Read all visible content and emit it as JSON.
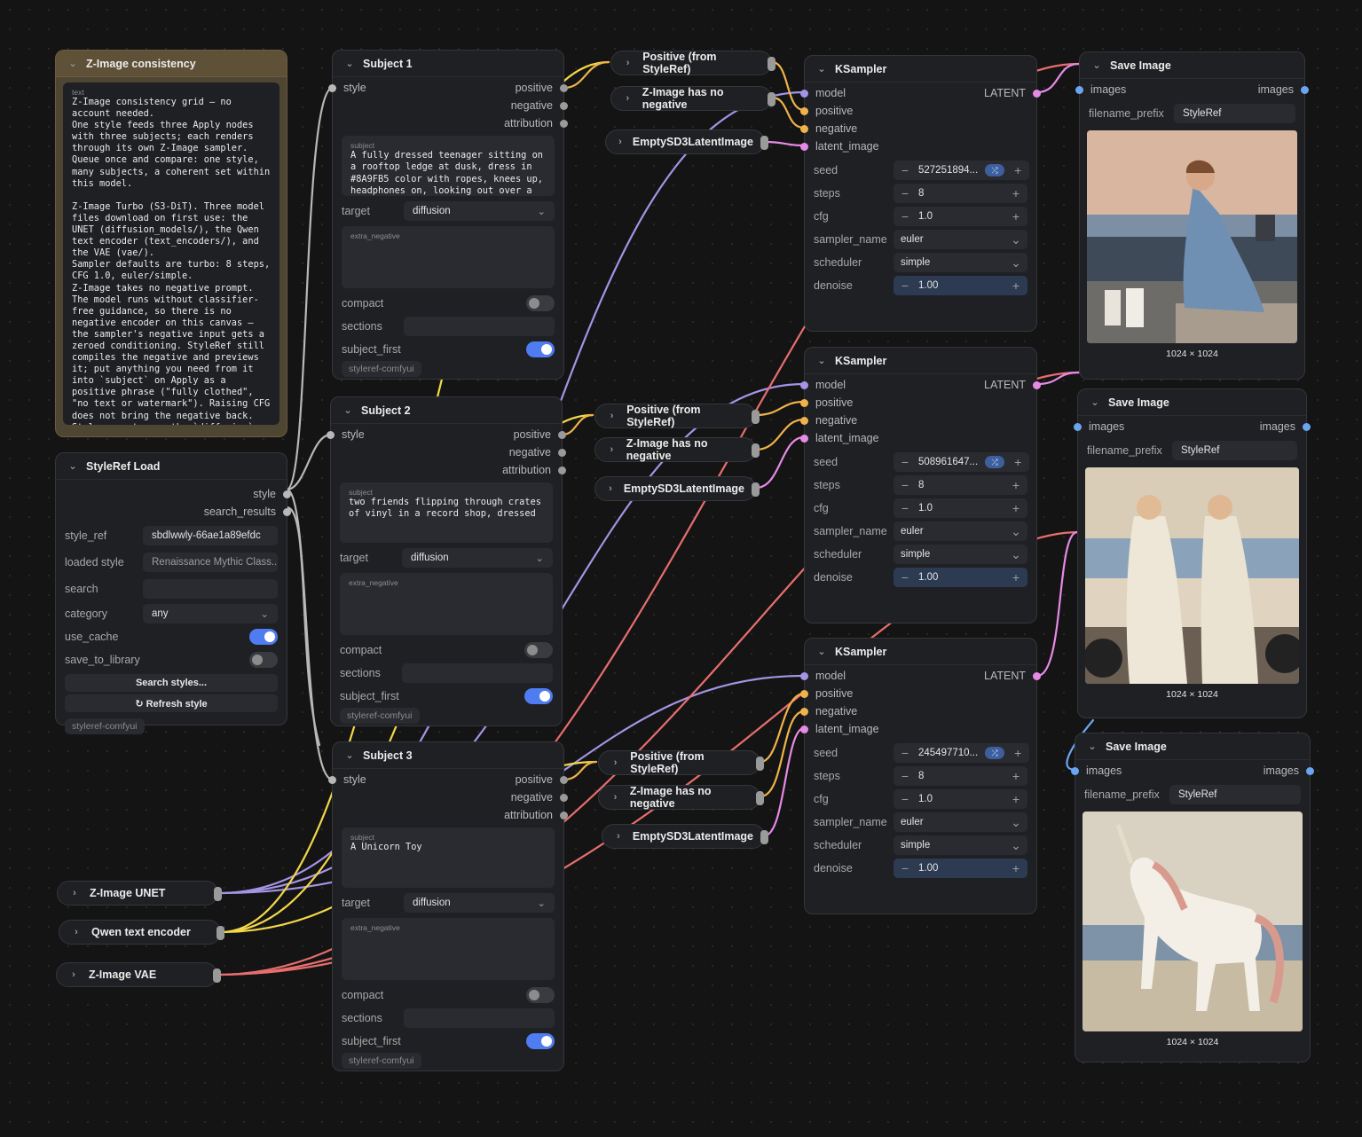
{
  "colors": {
    "model": "#a594e6",
    "conditioning": "#f0b34a",
    "latent": "#e78ae6",
    "image": "#6aa6f0",
    "style": "#b8b8b8",
    "clip": "#f2d84a",
    "vae": "#e86e6e"
  },
  "note": {
    "title": "Z-Image consistency",
    "caption": "text",
    "text": "Z-Image consistency grid — no account needed.\nOne style feeds three Apply nodes with three subjects; each renders through its own Z-Image sampler.\nQueue once and compare: one style, many subjects, a coherent set within this model.\n\nZ-Image Turbo (S3-DiT). Three model files download on first use: the UNET (diffusion_models/), the Qwen text encoder (text_encoders/), and the VAE (vae/).\nSampler defaults are turbo: 8 steps, CFG 1.0, euler/simple.\nZ-Image takes no negative prompt. The model runs without classifier-free guidance, so there is no negative encoder on this canvas — the sampler's negative input gets a zeroed conditioning. StyleRef still compiles the negative and previews it; put anything you need from it into `subject` on Apply as a positive phrase (\"fully clothed\", \"no text or watermark\"). Raising CFG does not bring the negative back.\nStyle prompts use the `diffusion`"
  },
  "styleref_load": {
    "title": "StyleRef Load",
    "out_style": "style",
    "out_search": "search_results",
    "style_ref_label": "style_ref",
    "style_ref_value": "sbdlwwly-66ae1a89efdc",
    "loaded_label": "loaded style",
    "loaded_value": "Renaissance Mythic Class...",
    "search_label": "search",
    "search_value": "",
    "category_label": "category",
    "category_value": "any",
    "use_cache_label": "use_cache",
    "save_label": "save_to_library",
    "search_btn": "Search styles...",
    "refresh_btn": "↻ Refresh style",
    "tag": "styleref-comfyui"
  },
  "subjects": [
    {
      "title": "Subject 1",
      "in_style": "style",
      "out_positive": "positive",
      "out_negative": "negative",
      "out_attribution": "attribution",
      "subject_caption": "subject",
      "subject_text": "A fully dressed teenager sitting on a rooftop ledge at dusk, dress in #8A9FB5 color with ropes, knees up, headphones on, looking out over a",
      "target_label": "target",
      "target_value": "diffusion",
      "neg_caption": "extra_negative",
      "compact_label": "compact",
      "sections_label": "sections",
      "subject_first_label": "subject_first",
      "tag": "styleref-comfyui"
    },
    {
      "title": "Subject 2",
      "in_style": "style",
      "out_positive": "positive",
      "out_negative": "negative",
      "out_attribution": "attribution",
      "subject_caption": "subject",
      "subject_text": "two friends flipping through crates of vinyl in a record shop, dressed",
      "target_label": "target",
      "target_value": "diffusion",
      "neg_caption": "extra_negative",
      "compact_label": "compact",
      "sections_label": "sections",
      "subject_first_label": "subject_first",
      "tag": "styleref-comfyui"
    },
    {
      "title": "Subject 3",
      "in_style": "style",
      "out_positive": "positive",
      "out_negative": "negative",
      "out_attribution": "attribution",
      "subject_caption": "subject",
      "subject_text": "A Unicorn Toy",
      "target_label": "target",
      "target_value": "diffusion",
      "neg_caption": "extra_negative",
      "compact_label": "compact",
      "sections_label": "sections",
      "subject_first_label": "subject_first",
      "tag": "styleref-comfyui"
    }
  ],
  "collapsed": [
    {
      "label": "Positive (from StyleRef)"
    },
    {
      "label": "Z-Image has no negative"
    },
    {
      "label": "EmptySD3LatentImage"
    },
    {
      "label": "Positive (from StyleRef)"
    },
    {
      "label": "Z-Image has no negative"
    },
    {
      "label": "EmptySD3LatentImage"
    },
    {
      "label": "Positive (from StyleRef)"
    },
    {
      "label": "Z-Image has no negative"
    },
    {
      "label": "EmptySD3LatentImage"
    },
    {
      "label": "Z-Image UNET"
    },
    {
      "label": "Qwen text encoder"
    },
    {
      "label": "Z-Image VAE"
    }
  ],
  "ksamplers": [
    {
      "title": "KSampler",
      "in_model": "model",
      "out_latent": "LATENT",
      "in_positive": "positive",
      "in_negative": "negative",
      "in_latent": "latent_image",
      "seed_label": "seed",
      "seed": "527251894...",
      "steps_label": "steps",
      "steps": "8",
      "cfg_label": "cfg",
      "cfg": "1.0",
      "sampler_label": "sampler_name",
      "sampler": "euler",
      "scheduler_label": "scheduler",
      "scheduler": "simple",
      "denoise_label": "denoise",
      "denoise": "1.00"
    },
    {
      "title": "KSampler",
      "in_model": "model",
      "out_latent": "LATENT",
      "in_positive": "positive",
      "in_negative": "negative",
      "in_latent": "latent_image",
      "seed_label": "seed",
      "seed": "508961647...",
      "steps_label": "steps",
      "steps": "8",
      "cfg_label": "cfg",
      "cfg": "1.0",
      "sampler_label": "sampler_name",
      "sampler": "euler",
      "scheduler_label": "scheduler",
      "scheduler": "simple",
      "denoise_label": "denoise",
      "denoise": "1.00"
    },
    {
      "title": "KSampler",
      "in_model": "model",
      "out_latent": "LATENT",
      "in_positive": "positive",
      "in_negative": "negative",
      "in_latent": "latent_image",
      "seed_label": "seed",
      "seed": "245497710...",
      "steps_label": "steps",
      "steps": "8",
      "cfg_label": "cfg",
      "cfg": "1.0",
      "sampler_label": "sampler_name",
      "sampler": "euler",
      "scheduler_label": "scheduler",
      "scheduler": "simple",
      "denoise_label": "denoise",
      "denoise": "1.00"
    }
  ],
  "save_images": [
    {
      "title": "Save Image",
      "in_images": "images",
      "out_images": "images",
      "prefix_label": "filename_prefix",
      "prefix": "StyleRef",
      "size": "1024 × 1024"
    },
    {
      "title": "Save Image",
      "in_images": "images",
      "out_images": "images",
      "prefix_label": "filename_prefix",
      "prefix": "StyleRef",
      "size": "1024 × 1024"
    },
    {
      "title": "Save Image",
      "in_images": "images",
      "out_images": "images",
      "prefix_label": "filename_prefix",
      "prefix": "StyleRef",
      "size": "1024 × 1024"
    }
  ]
}
